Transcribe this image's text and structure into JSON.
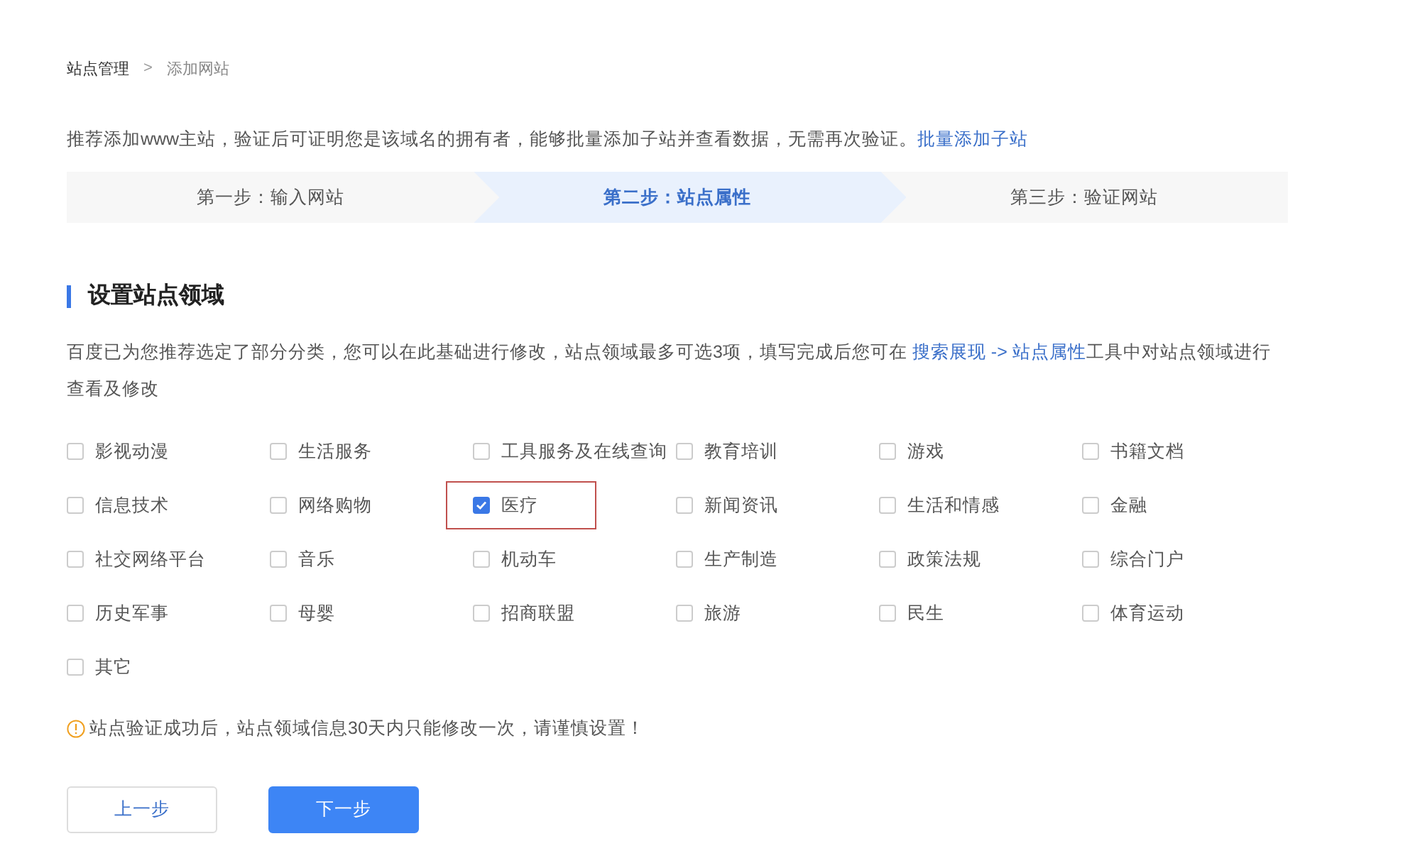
{
  "breadcrumb": [
    {
      "label": "站点管理",
      "current": false
    },
    {
      "label": "添加网站",
      "current": true
    }
  ],
  "breadcrumb_separator": ">",
  "intro": {
    "text": "推荐添加www主站，验证后可证明您是该域名的拥有者，能够批量添加子站并查看数据，无需再次验证。",
    "link": "批量添加子站"
  },
  "steps": [
    {
      "label": "第一步：输入网站",
      "selected": false
    },
    {
      "label": "第二步：站点属性",
      "selected": true
    },
    {
      "label": "第三步：验证网站",
      "selected": false
    }
  ],
  "section_title": "设置站点领域",
  "description": [
    {
      "kind": "text",
      "text": "百度已为您推荐选定了部分分类，您可以在此基础进行修改，站点领域最多可选3项，填写完成后您可在 "
    },
    {
      "kind": "link",
      "text": "搜索展现 -> 站点属性"
    },
    {
      "kind": "text",
      "text": "工具中对站点领域进行查看及修改"
    }
  ],
  "categories": [
    {
      "label": "影视动漫",
      "checked": false,
      "highlighted": false
    },
    {
      "label": "生活服务",
      "checked": false,
      "highlighted": false
    },
    {
      "label": "工具服务及在线查询",
      "checked": false,
      "highlighted": false
    },
    {
      "label": "教育培训",
      "checked": false,
      "highlighted": false
    },
    {
      "label": "游戏",
      "checked": false,
      "highlighted": false
    },
    {
      "label": "书籍文档",
      "checked": false,
      "highlighted": false
    },
    {
      "label": "信息技术",
      "checked": false,
      "highlighted": false
    },
    {
      "label": "网络购物",
      "checked": false,
      "highlighted": false
    },
    {
      "label": "医疗",
      "checked": true,
      "highlighted": true
    },
    {
      "label": "新闻资讯",
      "checked": false,
      "highlighted": false
    },
    {
      "label": "生活和情感",
      "checked": false,
      "highlighted": false
    },
    {
      "label": "金融",
      "checked": false,
      "highlighted": false
    },
    {
      "label": "社交网络平台",
      "checked": false,
      "highlighted": false
    },
    {
      "label": "音乐",
      "checked": false,
      "highlighted": false
    },
    {
      "label": "机动车",
      "checked": false,
      "highlighted": false
    },
    {
      "label": "生产制造",
      "checked": false,
      "highlighted": false
    },
    {
      "label": "政策法规",
      "checked": false,
      "highlighted": false
    },
    {
      "label": "综合门户",
      "checked": false,
      "highlighted": false
    },
    {
      "label": "历史军事",
      "checked": false,
      "highlighted": false
    },
    {
      "label": "母婴",
      "checked": false,
      "highlighted": false
    },
    {
      "label": "招商联盟",
      "checked": false,
      "highlighted": false
    },
    {
      "label": "旅游",
      "checked": false,
      "highlighted": false
    },
    {
      "label": "民生",
      "checked": false,
      "highlighted": false
    },
    {
      "label": "体育运动",
      "checked": false,
      "highlighted": false
    },
    {
      "label": "其它",
      "checked": false,
      "highlighted": false
    }
  ],
  "warning": "站点验证成功后，站点领域信息30天内只能修改一次，请谨慎设置！",
  "buttons": [
    {
      "label": "上一步",
      "kind": "secondary"
    },
    {
      "label": "下一步",
      "kind": "primary"
    }
  ]
}
